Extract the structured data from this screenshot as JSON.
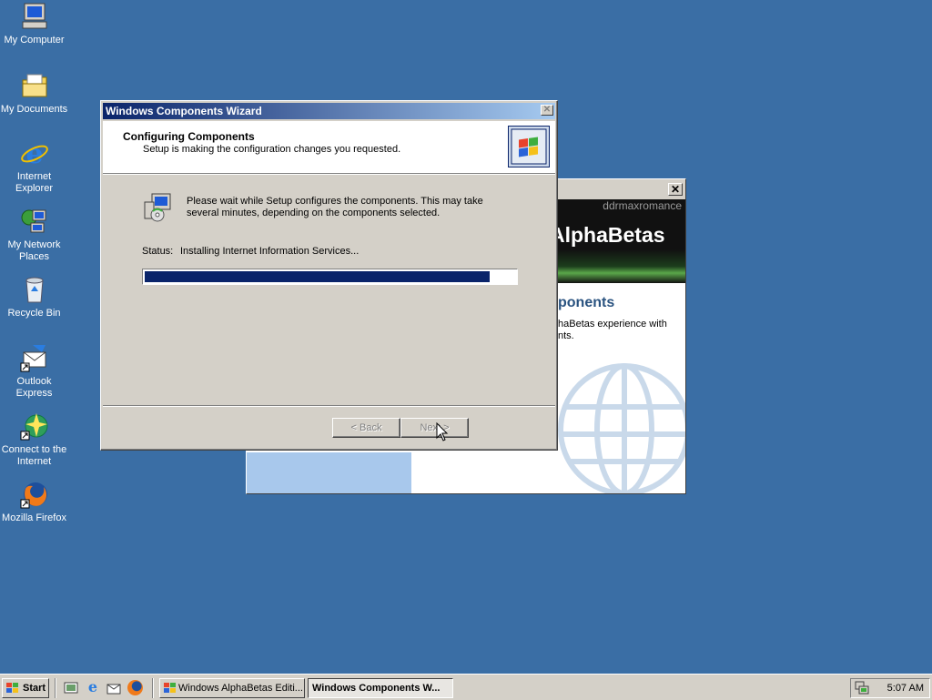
{
  "desktop": {
    "icons": [
      {
        "label": "My Computer",
        "icon": "computer-icon"
      },
      {
        "label": "My Documents",
        "icon": "folder-icon"
      },
      {
        "label": "Internet Explorer",
        "icon": "ie-icon"
      },
      {
        "label": "My Network Places",
        "icon": "network-icon"
      },
      {
        "label": "Recycle Bin",
        "icon": "recycle-bin-icon"
      },
      {
        "label": "Outlook Express",
        "icon": "outlook-icon"
      },
      {
        "label": "Connect to the Internet",
        "icon": "connect-icon"
      },
      {
        "label": "Mozilla Firefox",
        "icon": "firefox-icon"
      }
    ]
  },
  "background_window": {
    "watermark": "ddrmaxromance",
    "banner_text": "AlphaBetas",
    "heading": "ponents",
    "body_line1": "haBetas experience with",
    "body_line2": "nts."
  },
  "wizard": {
    "title": "Windows Components Wizard",
    "header_title": "Configuring Components",
    "header_subtitle": "Setup is making the configuration changes you requested.",
    "message_line1": "Please wait while Setup configures the components. This may take",
    "message_line2": "several minutes, depending on the components selected.",
    "status_label": "Status:",
    "status_value": "Installing Internet Information Services...",
    "progress_percent": 93,
    "back_label": "< Back",
    "next_label": "Next >"
  },
  "taskbar": {
    "start_label": "Start",
    "tasks": [
      {
        "label": "Windows AlphaBetas Editi...",
        "active": false
      },
      {
        "label": "Windows Components W...",
        "active": true
      }
    ],
    "clock": "5:07 AM"
  },
  "colors": {
    "desktop": "#3a6ea5",
    "title_active": "#0a246a",
    "progress_fill": "#0a246a"
  }
}
